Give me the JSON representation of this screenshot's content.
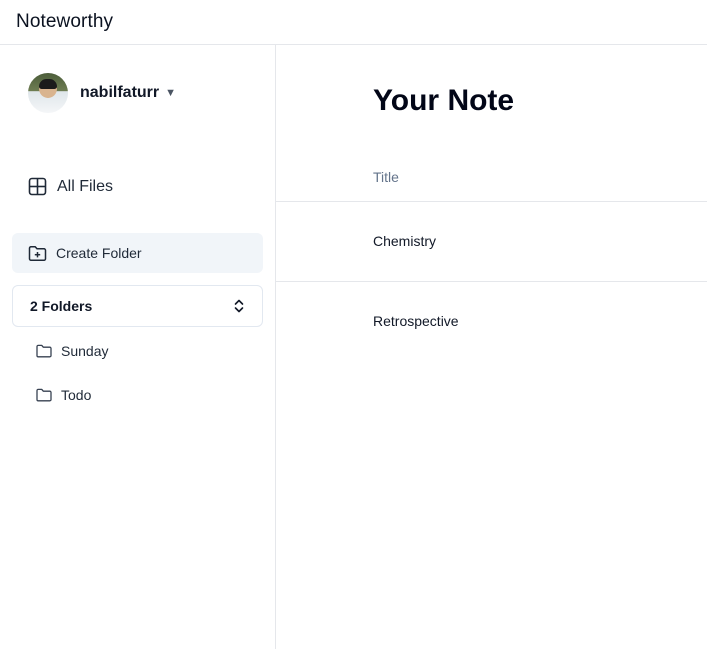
{
  "header": {
    "app_title": "Noteworthy"
  },
  "sidebar": {
    "user": {
      "name": "nabilfaturr",
      "caret": "▼"
    },
    "all_files_label": "All Files",
    "create_folder_label": "Create Folder",
    "folders_select": {
      "value": "2 Folders"
    },
    "folders": [
      {
        "name": "Sunday",
        "icon": "folder-icon"
      },
      {
        "name": "Todo",
        "icon": "folder-icon"
      }
    ]
  },
  "main": {
    "title": "Your Note",
    "table": {
      "columns": [
        "Title"
      ],
      "rows": [
        {
          "title": "Chemistry"
        },
        {
          "title": "Retrospective"
        }
      ]
    }
  },
  "colors": {
    "border": "#e5e7eb",
    "create_folder_bg": "#f1f5f9",
    "muted_text": "#64748b"
  }
}
